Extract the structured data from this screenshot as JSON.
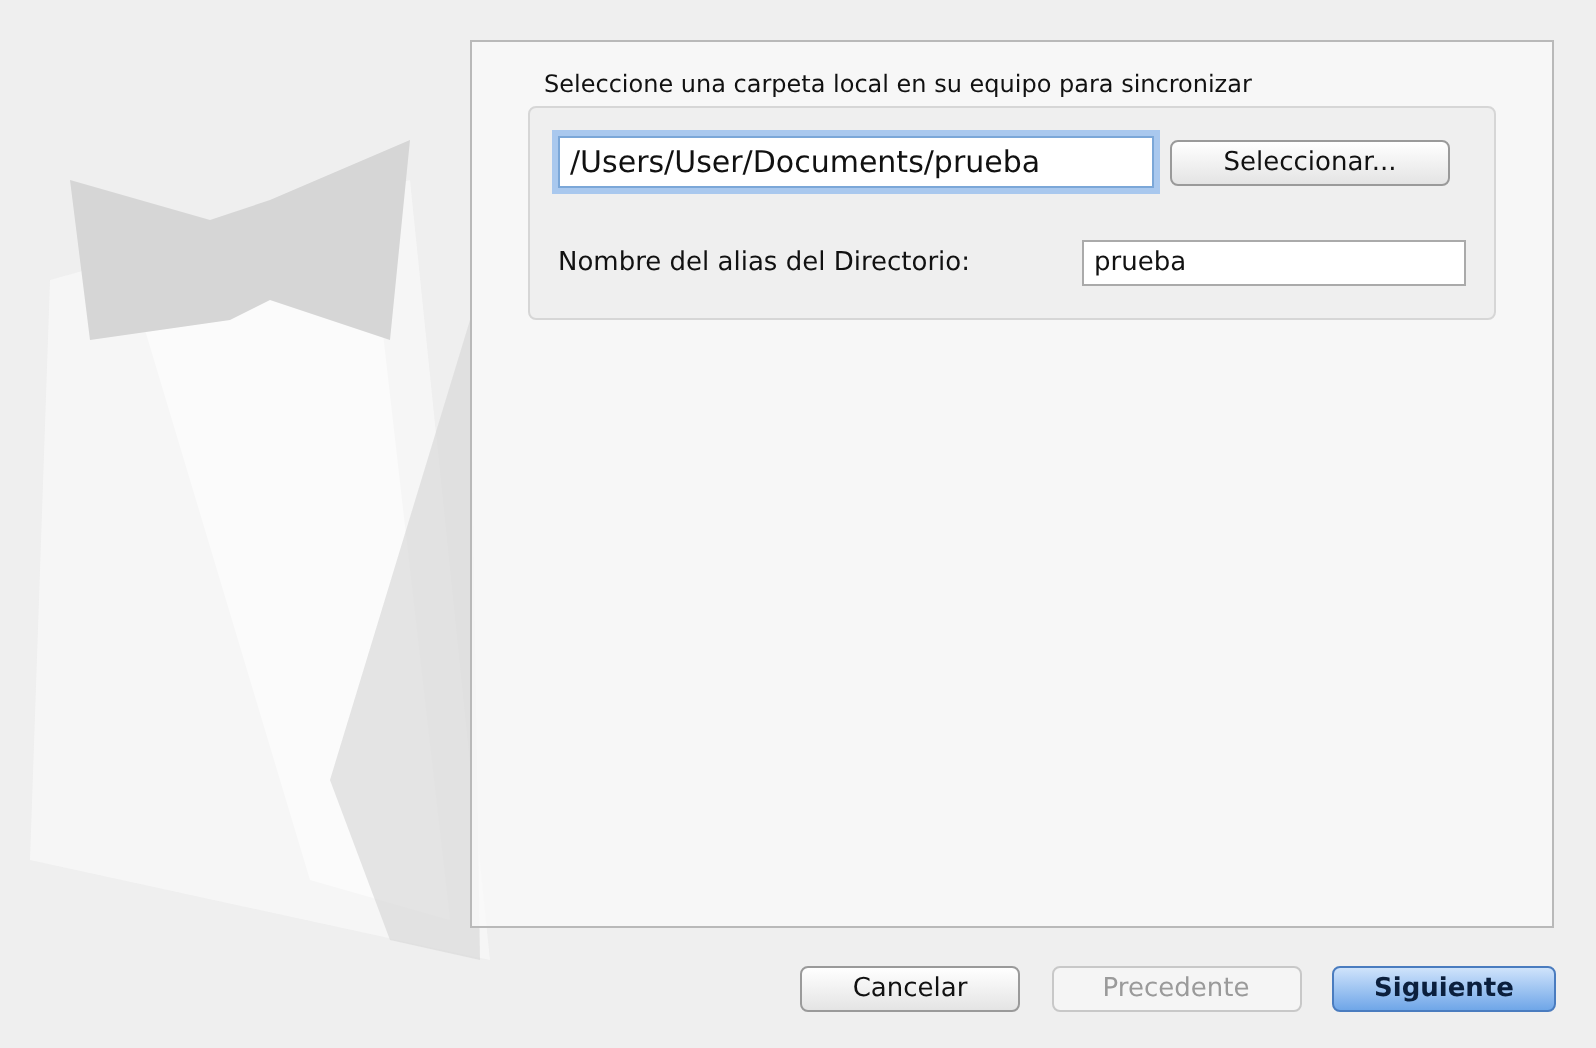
{
  "dialog": {
    "group_title": "Seleccione una carpeta local en su equipo para sincronizar",
    "path_field": {
      "value": "/Users/User/Documents/prueba",
      "focused": true
    },
    "choose_button": "Seleccionar...",
    "alias_label": "Nombre del alias del Directorio:",
    "alias_field": {
      "value": "prueba"
    }
  },
  "buttons": [
    {
      "label": "Cancelar",
      "disabled": false,
      "default": false
    },
    {
      "label": "Precedente",
      "disabled": true,
      "default": false
    },
    {
      "label": "Siguiente",
      "disabled": false,
      "default": true
    }
  ]
}
